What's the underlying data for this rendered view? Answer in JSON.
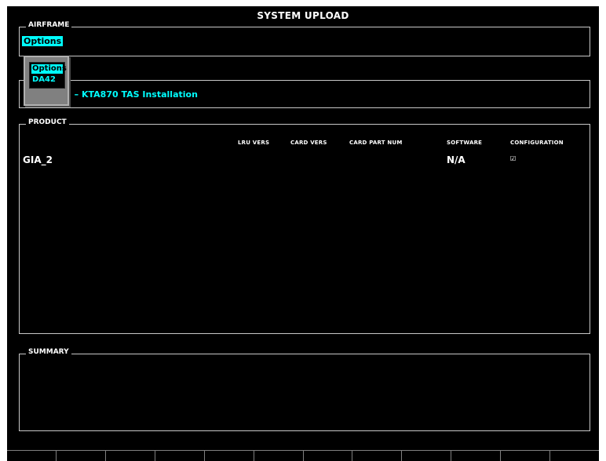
{
  "window": {
    "title": "SYSTEM UPLOAD"
  },
  "airframe": {
    "label": "AIRFRAME",
    "selected_value": "Options"
  },
  "file": {
    "visible_text": "n – KTA870 TAS Installation"
  },
  "popup": {
    "items": [
      {
        "label": "Options",
        "selected": true
      },
      {
        "label": "DA42",
        "selected": false
      }
    ]
  },
  "product": {
    "label": "PRODUCT",
    "columns": [
      "LRU VERS",
      "CARD VERS",
      "CARD PART NUM",
      "SOFTWARE",
      "CONFIGURATION"
    ],
    "rows": [
      {
        "name": "GIA_2",
        "lru_vers": "",
        "card_vers": "",
        "card_part_num": "",
        "software": "N/A",
        "configuration_checked": true,
        "configuration_icon": "check-icon",
        "configuration_glyph": "☑"
      }
    ]
  },
  "summary": {
    "label": "SUMMARY"
  },
  "softkeys": {
    "count": 12
  },
  "colors": {
    "background": "#000000",
    "accent": "#00ffff",
    "text": "#ffffff",
    "border": "#c8c8c8"
  }
}
